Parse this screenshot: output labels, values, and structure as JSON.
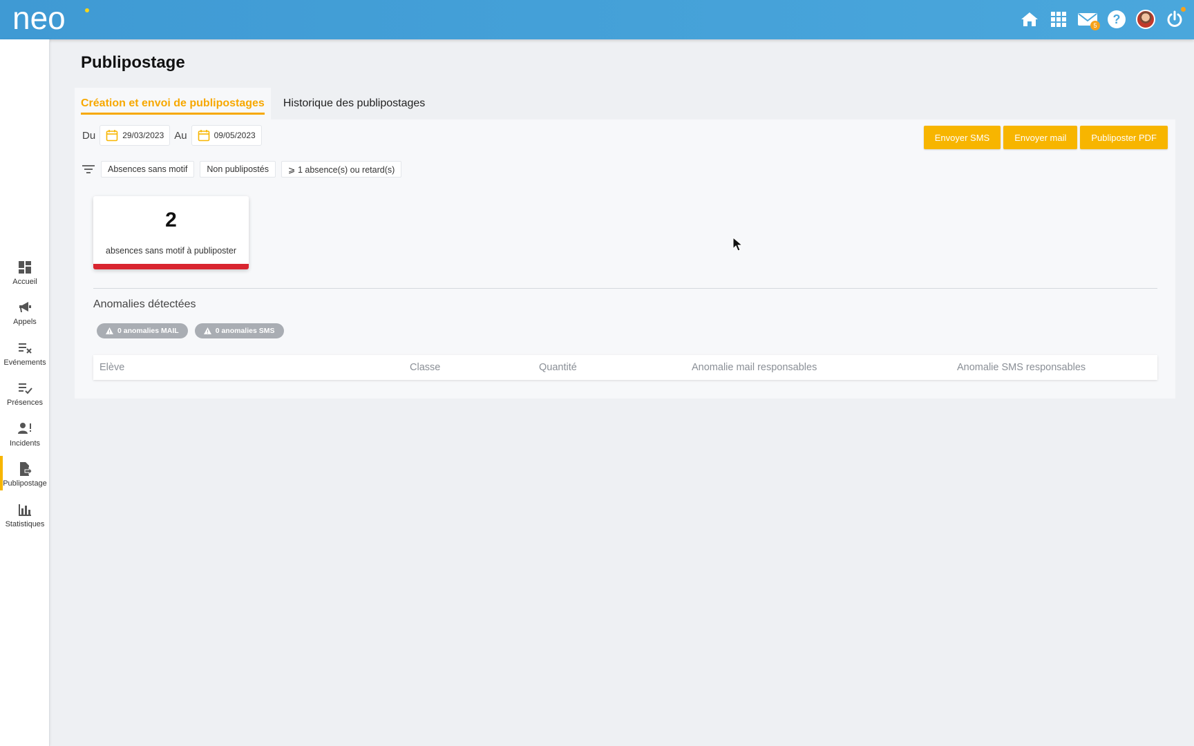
{
  "header": {
    "logo_text": "neo",
    "icons": [
      "home-icon",
      "apps-grid-icon",
      "mail-icon",
      "help-icon",
      "avatar",
      "power-icon"
    ],
    "mail_badge": "5",
    "colors": {
      "bar": "#4aa7dc",
      "accent": "#f7b500"
    }
  },
  "sidebar": {
    "items": [
      {
        "label": "Accueil",
        "icon": "dashboard-icon"
      },
      {
        "label": "Appels",
        "icon": "megaphone-icon"
      },
      {
        "label": "Evénements",
        "icon": "event-list-icon"
      },
      {
        "label": "Présences",
        "icon": "checklist-icon"
      },
      {
        "label": "Incidents",
        "icon": "person-alert-icon"
      },
      {
        "label": "Publipostage",
        "icon": "document-send-icon",
        "active": true
      },
      {
        "label": "Statistiques",
        "icon": "bar-chart-icon"
      }
    ]
  },
  "page": {
    "title": "Publipostage",
    "tabs": [
      {
        "label": "Création et envoi de publipostages",
        "active": true
      },
      {
        "label": "Historique des publipostages",
        "active": false
      }
    ]
  },
  "dates": {
    "from_label": "Du",
    "from_value": "29/03/2023",
    "to_label": "Au",
    "to_value": "09/05/2023"
  },
  "actions": {
    "sms": "Envoyer SMS",
    "mail": "Envoyer mail",
    "pdf": "Publiposter PDF"
  },
  "filters": [
    "Absences sans motif",
    "Non publipostés",
    "⩾ 1 absence(s) ou retard(s)"
  ],
  "stat_card": {
    "value": "2",
    "label": "absences sans motif à publiposter",
    "bar_color": "#d9252f"
  },
  "anomalies": {
    "title": "Anomalies détectées",
    "mail_badge": "0 anomalies MAIL",
    "sms_badge": "0 anomalies SMS"
  },
  "table": {
    "columns": [
      "Elève",
      "Classe",
      "Quantité",
      "Anomalie mail responsables",
      "Anomalie SMS responsables"
    ]
  }
}
